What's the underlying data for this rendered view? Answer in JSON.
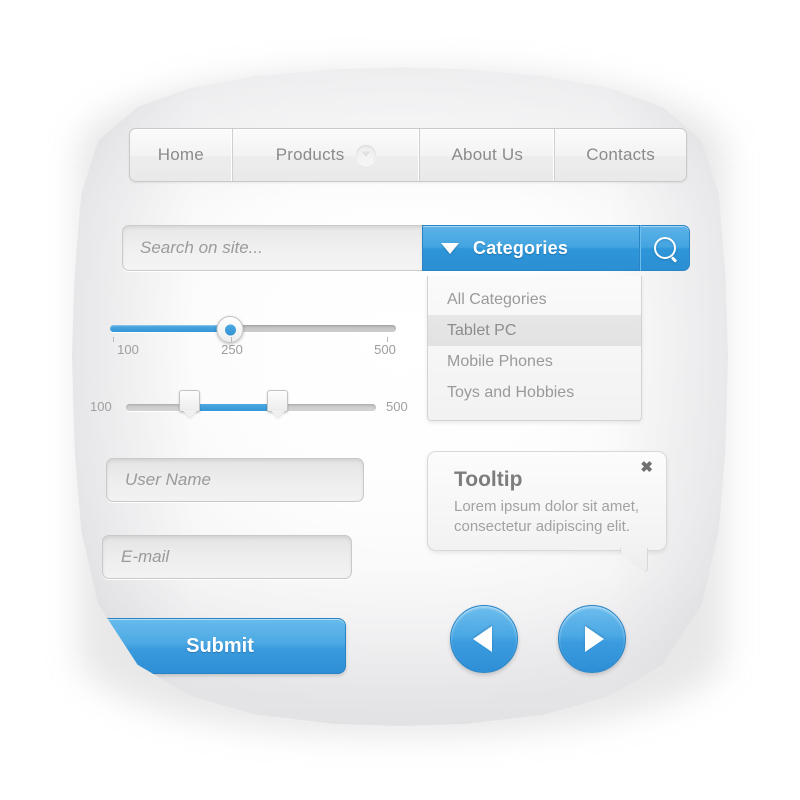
{
  "nav": {
    "items": [
      {
        "label": "Home",
        "has_chevron": false
      },
      {
        "label": "Products",
        "has_chevron": true,
        "chevron_icon": "chevron-down-icon"
      },
      {
        "label": "About Us",
        "has_chevron": false
      },
      {
        "label": "Contacts",
        "has_chevron": false
      }
    ]
  },
  "search": {
    "placeholder": "Search on site...",
    "value": "",
    "categories_label": "Categories",
    "dropdown_icon": "triangle-down-icon",
    "go_icon": "search-icon"
  },
  "categories_dropdown": {
    "items": [
      {
        "label": "All Categories",
        "selected": false
      },
      {
        "label": "Tablet PC",
        "selected": true
      },
      {
        "label": "Mobile Phones",
        "selected": false
      },
      {
        "label": "Toys and Hobbies",
        "selected": false
      }
    ]
  },
  "slider_single": {
    "min_label": "100",
    "mid_label": "250",
    "max_label": "500",
    "value": 250,
    "min": 100,
    "max": 500,
    "fill_percent": 42
  },
  "slider_range": {
    "min_label": "100",
    "max_label": "500",
    "min": 100,
    "max": 500,
    "value_low": 200,
    "value_high": 340
  },
  "form": {
    "username_placeholder": "User Name",
    "username_value": "",
    "email_placeholder": "E-mail",
    "email_value": "",
    "submit_label": "Submit"
  },
  "tooltip": {
    "title": "Tooltip",
    "body_line1": "Lorem ipsum dolor sit amet,",
    "body_line2": "consectetur adipiscing elit.",
    "close_glyph": "✖",
    "close_icon": "close-icon"
  },
  "pager": {
    "prev_icon": "triangle-left-icon",
    "next_icon": "triangle-right-icon"
  },
  "colors": {
    "accent_blue": "#3a9add",
    "accent_blue_light": "#68bbec",
    "accent_blue_dark": "#2b85c4",
    "surface": "#f2f2f2",
    "text_muted": "#9a9a9a",
    "text_strong": "#7d7d7d",
    "pillow": "#ffffff"
  }
}
